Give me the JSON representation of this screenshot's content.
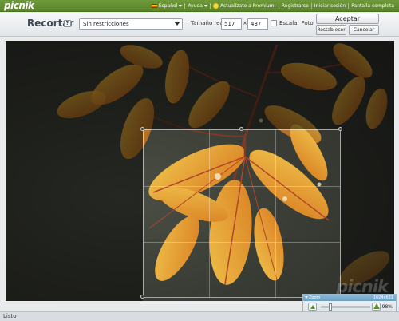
{
  "app": {
    "logo": "picnik"
  },
  "topnav": {
    "language": "Español",
    "help": "Ayuda",
    "premium": "Actualízate a Premium!",
    "register": "Registrarse",
    "login": "Iniciar sesión",
    "fullscreen": "Pantalla completa"
  },
  "toolbar": {
    "title": "Recortar",
    "help_glyph": "?",
    "constraint": "Sin restricciones",
    "size_label": "Tamaño real",
    "width": "517",
    "times": "×",
    "height": "437",
    "scale_label": "Escalar Foto",
    "accept": "Aceptar",
    "reset": "Restablecer",
    "cancel": "Cancelar"
  },
  "canvas": {
    "watermark": "picnik"
  },
  "zoom": {
    "title": "Zoom",
    "dimensions": "1024x681",
    "percent": "98%",
    "level": 0.98
  },
  "status": {
    "text": "Listo"
  },
  "colors": {
    "topbar": "#6f9a3a",
    "leaf_orange": "#e39a2c",
    "leaf_yellow": "#e8b531",
    "vein": "#b2452a"
  }
}
